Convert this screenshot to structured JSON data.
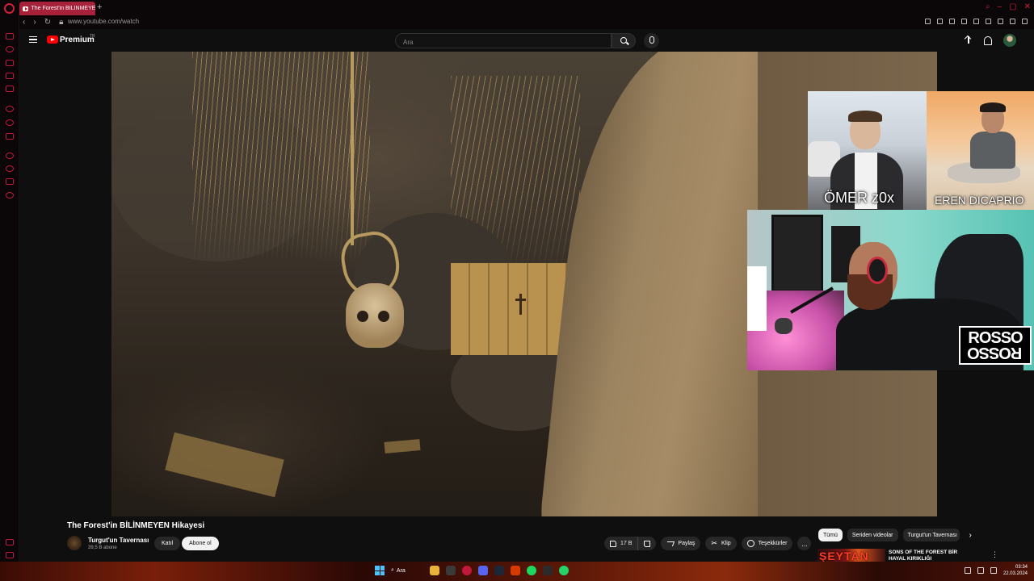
{
  "browser": {
    "tab_title": "The Forest'in BİLİNMEYEN",
    "new_tab": "+",
    "url": "www.youtube.com/watch"
  },
  "youtube": {
    "brand": "Premium",
    "region": "TR",
    "search_placeholder": "Ara"
  },
  "overlays": {
    "cam1_name": "ÖMER z0x",
    "cam2_name": "EREN DICAPRIO",
    "logo_top": "ROSSO",
    "logo_bottom": "ROSSO"
  },
  "video": {
    "title": "The Forest'in BİLİNMEYEN Hikayesi",
    "channel": "Turgut'un Tavernası",
    "subscribers": "39,5 B abone",
    "join_label": "Katıl",
    "subscribe_label": "Abone ol",
    "likes": "17 B",
    "share_label": "Paylaş",
    "clip_label": "Klip",
    "thanks_label": "Teşekkürler",
    "more_label": "..."
  },
  "chips": [
    "Tümü",
    "Seriden videolar",
    "Turgut'un Tavernası"
  ],
  "recommended": {
    "thumb_text": "ŞEYTAN",
    "title": "SONS OF THE FOREST BİR HAYAL KIRIKLIĞI"
  },
  "taskbar": {
    "search_label": "Ara",
    "time": "03:34",
    "date": "22.03.2024"
  },
  "colors": {
    "opera_red": "#c2183b",
    "yt_red": "#ff0000",
    "yt_bg": "#0f0f0f"
  }
}
